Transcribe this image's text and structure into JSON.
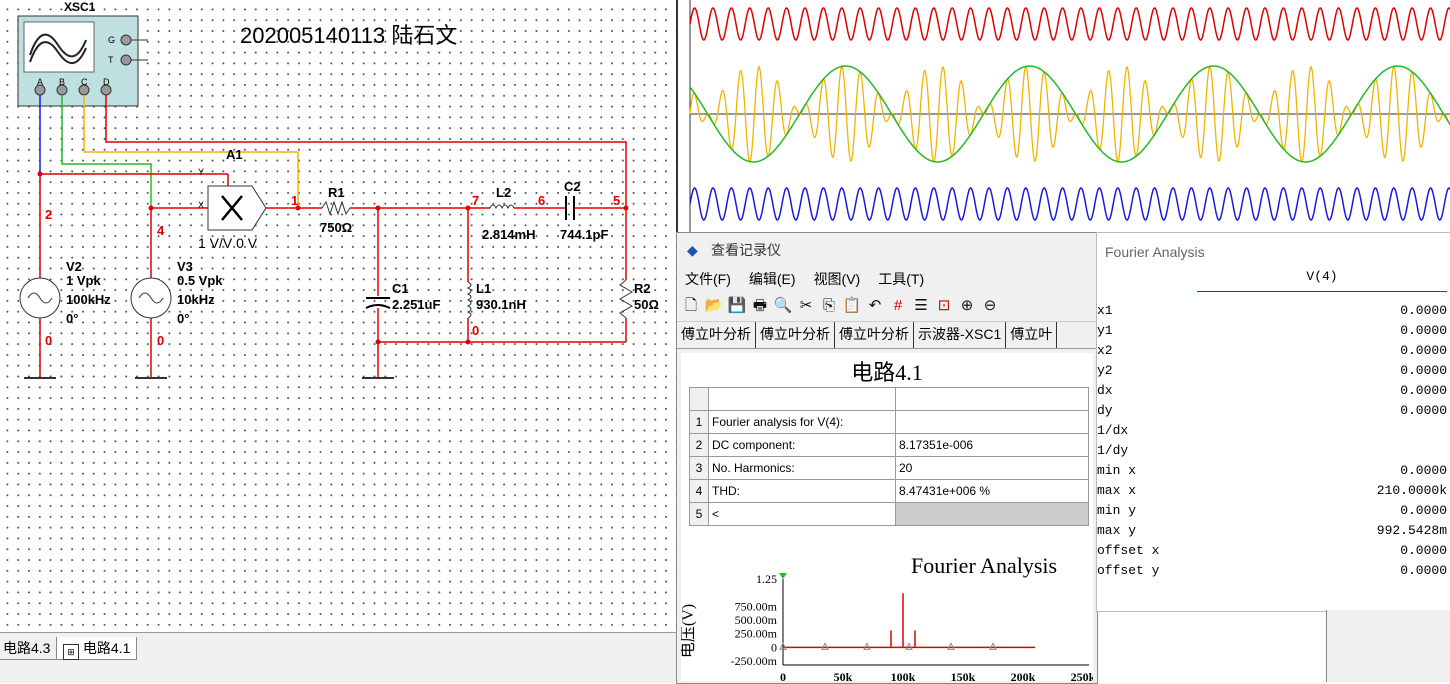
{
  "author": {
    "id": "202005140113",
    "name": "陆石文"
  },
  "schematic": {
    "scope_label": "XSC1",
    "scope_terminals": {
      "g": "G",
      "t": "T",
      "a": "A",
      "b": "B",
      "c": "C",
      "d": "D"
    },
    "multiplier_label": "A1",
    "multiplier_params": "1 V/V 0 V",
    "multiplier_in_x": "X",
    "multiplier_in_y": "Y",
    "v2": {
      "name": "V2",
      "amp": "1 Vpk",
      "freq": "100kHz",
      "phase": "0°"
    },
    "v3": {
      "name": "V3",
      "amp": "0.5 Vpk",
      "freq": "10kHz",
      "phase": "0°"
    },
    "r1": {
      "name": "R1",
      "value": "750Ω"
    },
    "r2": {
      "name": "R2",
      "value": "50Ω"
    },
    "l1": {
      "name": "L1",
      "value": "930.1nH"
    },
    "l2": {
      "name": "L2",
      "value": "2.814mH"
    },
    "c1": {
      "name": "C1",
      "value": "2.251uF"
    },
    "c2": {
      "name": "C2",
      "value": "744.1pF"
    },
    "nodes": {
      "n1": "1",
      "n2": "2",
      "n4": "4",
      "n5": "5",
      "n6": "6",
      "n7": "7",
      "n0": "0"
    }
  },
  "tabs": [
    {
      "label": "电路4.3"
    },
    {
      "label": "电路4.1"
    }
  ],
  "grapher": {
    "title": "查看记录仪",
    "menu": [
      "文件(F)",
      "编辑(E)",
      "视图(V)",
      "工具(T)"
    ],
    "tabs": [
      "傅立叶分析",
      "傅立叶分析",
      "傅立叶分析",
      "示波器-XSC1",
      "傅立叶"
    ],
    "circuit_title": "电路4.1",
    "table": [
      {
        "n": "1",
        "name": "Fourier analysis for V(4):",
        "value": ""
      },
      {
        "n": "2",
        "name": "DC component:",
        "value": "8.17351e-006"
      },
      {
        "n": "3",
        "name": "No. Harmonics:",
        "value": "20"
      },
      {
        "n": "4",
        "name": "THD:",
        "value": "8.47431e+006 %"
      },
      {
        "n": "5",
        "name": "<",
        "value": ""
      }
    ]
  },
  "chart_data": {
    "type": "bar",
    "title": "Fourier Analysis",
    "ylabel": "电压(V)",
    "xlabel": "",
    "x_ticks": [
      "0",
      "50k",
      "100k",
      "150k",
      "200k",
      "250k"
    ],
    "y_ticks": [
      "1.25",
      "750.00m",
      "500.00m",
      "250.00m",
      "0",
      "-250.00m"
    ],
    "xlim": [
      0,
      250000
    ],
    "ylim": [
      -0.25,
      1.25
    ],
    "series": [
      {
        "x": [
          90000,
          100000,
          110000
        ],
        "values": [
          0.31,
          0.99,
          0.31
        ]
      }
    ],
    "markers_x": [
      0,
      35000,
      70000,
      105000,
      140000,
      175000
    ]
  },
  "cursor_panel": {
    "title": "Fourier Analysis",
    "column": "V(4)",
    "rows": [
      {
        "k": "x1",
        "v": "0.0000"
      },
      {
        "k": "y1",
        "v": "0.0000"
      },
      {
        "k": "x2",
        "v": "0.0000"
      },
      {
        "k": "y2",
        "v": "0.0000"
      },
      {
        "k": "dx",
        "v": "0.0000"
      },
      {
        "k": "dy",
        "v": "0.0000"
      },
      {
        "k": "1/dx",
        "v": ""
      },
      {
        "k": "1/dy",
        "v": ""
      },
      {
        "k": "min x",
        "v": "0.0000"
      },
      {
        "k": "max x",
        "v": "210.0000k"
      },
      {
        "k": "min y",
        "v": "0.0000"
      },
      {
        "k": "max y",
        "v": "992.5428m"
      },
      {
        "k": "offset x",
        "v": "0.0000"
      },
      {
        "k": "offset y",
        "v": "0.0000"
      }
    ]
  },
  "colors": {
    "red": "#e00000",
    "blue": "#1a1adf",
    "green": "#22bb22",
    "orange": "#f0b400"
  }
}
